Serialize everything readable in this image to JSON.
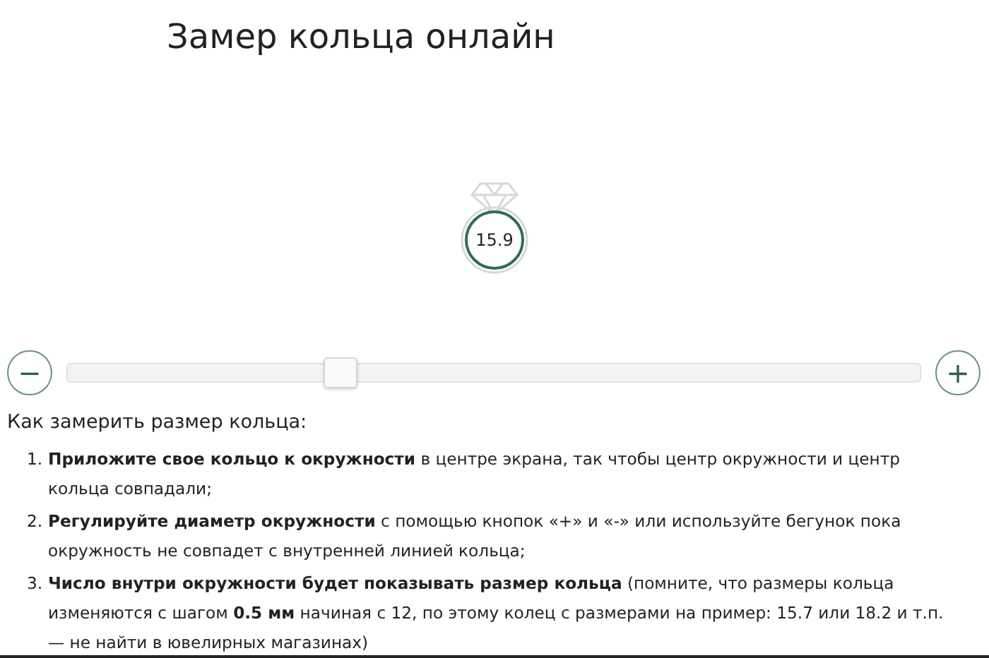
{
  "title": "Замер кольца онлайн",
  "ring": {
    "size": "15.9"
  },
  "slider": {
    "minus": "−",
    "plus": "+",
    "level": 0.32
  },
  "instructions": {
    "heading": "Как замерить размер кольца:",
    "steps": [
      {
        "number": "1.",
        "text": "**Приложите свое кольцо к окружности** в центре экрана, так чтобы центр окружности и центр кольца совпадали;"
      },
      {
        "number": "2.",
        "text": "**Регулируйте диаметр окружности** с помощью кнопок «+» и «-» или используйте бегунок пока окружность не совпадет с внутренней линией кольца;"
      },
      {
        "number": "3.",
        "text": "**Число внутри окружности будет показывать размер кольца** (помните, что размеры кольца изменяются с шагом **0.5 мм** начиная с 12, по этому колец с размерами на пример: 15.7 или 18.2 и т.п. — не найти в ювелирных магазинах)"
      }
    ]
  }
}
